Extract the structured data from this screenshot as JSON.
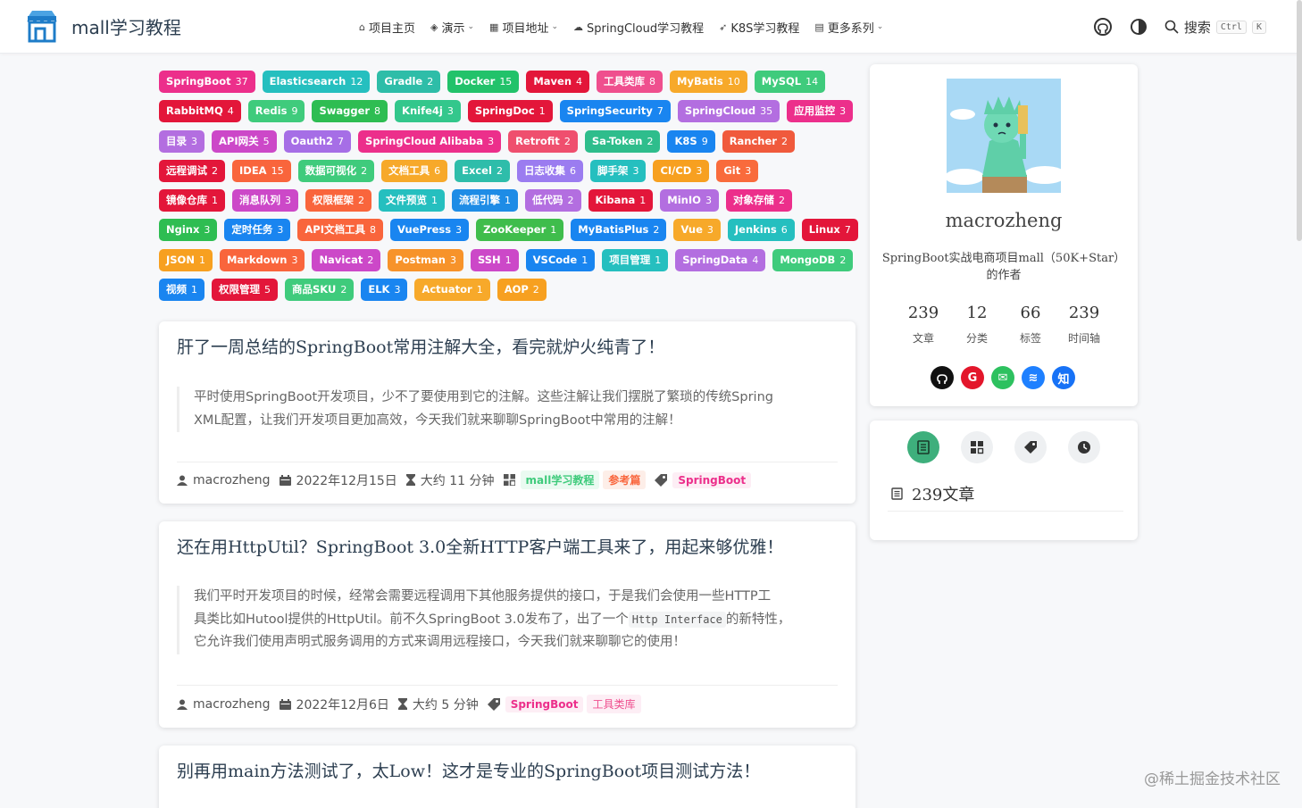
{
  "brand": {
    "name": "mall学习教程"
  },
  "nav": {
    "links": [
      {
        "icon": "home-icon",
        "label": "项目主页",
        "caret": false
      },
      {
        "icon": "cube-icon",
        "label": "演示",
        "caret": true
      },
      {
        "icon": "grid-icon",
        "label": "项目地址",
        "caret": true
      },
      {
        "icon": "cloud-icon",
        "label": "SpringCloud学习教程",
        "caret": false
      },
      {
        "icon": "rocket-icon",
        "label": "K8S学习教程",
        "caret": false
      },
      {
        "icon": "book-icon",
        "label": "更多系列",
        "caret": true
      }
    ],
    "search_label": "搜索",
    "kbd1": "Ctrl",
    "kbd2": "K"
  },
  "tags": [
    [
      [
        "SpringBoot",
        "37",
        "#ec2f8b"
      ],
      [
        "Elasticsearch",
        "12",
        "#25bfbf"
      ],
      [
        "Gradle",
        "2",
        "#2ebda8"
      ],
      [
        "Docker",
        "15",
        "#22c26a"
      ],
      [
        "Maven",
        "4",
        "#e3163a"
      ],
      [
        "工具类库",
        "8",
        "#ef4f8e"
      ],
      [
        "MyBatis",
        "10",
        "#f7a92a"
      ],
      [
        "MySQL",
        "14",
        "#3fcb7c"
      ]
    ],
    [
      [
        "RabbitMQ",
        "4",
        "#e3163a"
      ],
      [
        "Redis",
        "9",
        "#3fcb7c"
      ],
      [
        "Swagger",
        "8",
        "#2ebd52"
      ],
      [
        "Knife4j",
        "3",
        "#33c78c"
      ],
      [
        "SpringDoc",
        "1",
        "#e3163a"
      ],
      [
        "SpringSecurity",
        "7",
        "#1985f0"
      ],
      [
        "SpringCloud",
        "35",
        "#b36ee0"
      ],
      [
        "应用监控",
        "3",
        "#ec2f8b"
      ]
    ],
    [
      [
        "目录",
        "3",
        "#b36ee0"
      ],
      [
        "API网关",
        "5",
        "#cc48c8"
      ],
      [
        "Oauth2",
        "7",
        "#a66ee6"
      ],
      [
        "SpringCloud Alibaba",
        "3",
        "#ec2f8b"
      ],
      [
        "Retrofit",
        "2",
        "#ef4f6e"
      ],
      [
        "Sa-Token",
        "2",
        "#2ebd8c"
      ],
      [
        "K8S",
        "9",
        "#1985f0"
      ],
      [
        "Rancher",
        "2",
        "#f05a3c"
      ]
    ],
    [
      [
        "远程调试",
        "2",
        "#e3163a"
      ],
      [
        "IDEA",
        "15",
        "#f9653c"
      ],
      [
        "数据可视化",
        "2",
        "#3fcb7c"
      ],
      [
        "文档工具",
        "6",
        "#f7a92a"
      ],
      [
        "Excel",
        "2",
        "#2ebdaa"
      ],
      [
        "日志收集",
        "6",
        "#9b7cf0"
      ],
      [
        "脚手架",
        "3",
        "#25bfbf"
      ],
      [
        "CI/CD",
        "3",
        "#f7a020"
      ],
      [
        "Git",
        "3",
        "#f96b3c"
      ]
    ],
    [
      [
        "镜像仓库",
        "1",
        "#e3163a"
      ],
      [
        "消息队列",
        "3",
        "#cc48c8"
      ],
      [
        "权限框架",
        "2",
        "#f9653c"
      ],
      [
        "文件预览",
        "1",
        "#25bfbf"
      ],
      [
        "流程引擎",
        "1",
        "#1e8ce6"
      ],
      [
        "低代码",
        "2",
        "#b36ee0"
      ],
      [
        "Kibana",
        "1",
        "#e3163a"
      ],
      [
        "MinIO",
        "3",
        "#b36ee0"
      ],
      [
        "对象存储",
        "2",
        "#ec2f8b"
      ]
    ],
    [
      [
        "Nginx",
        "3",
        "#2ebd52"
      ],
      [
        "定时任务",
        "3",
        "#1985f0"
      ],
      [
        "API文档工具",
        "8",
        "#f9653c"
      ],
      [
        "VuePress",
        "3",
        "#1985f0"
      ],
      [
        "ZooKeeper",
        "1",
        "#3fbd4c"
      ],
      [
        "MyBatisPlus",
        "2",
        "#1985f0"
      ],
      [
        "Vue",
        "3",
        "#f7a92a"
      ],
      [
        "Jenkins",
        "6",
        "#25bfbf"
      ],
      [
        "Linux",
        "7",
        "#e3163a"
      ]
    ],
    [
      [
        "JSON",
        "1",
        "#f7a020"
      ],
      [
        "Markdown",
        "3",
        "#f9653c"
      ],
      [
        "Navicat",
        "2",
        "#cc48c8"
      ],
      [
        "Postman",
        "3",
        "#f7932a"
      ],
      [
        "SSH",
        "1",
        "#cc48c8"
      ],
      [
        "VSCode",
        "1",
        "#1985f0"
      ],
      [
        "项目管理",
        "1",
        "#25bfbf"
      ],
      [
        "SpringData",
        "4",
        "#b36ee0"
      ],
      [
        "MongoDB",
        "2",
        "#3fcb7c"
      ]
    ],
    [
      [
        "视频",
        "1",
        "#1985f0"
      ],
      [
        "权限管理",
        "5",
        "#e3163a"
      ],
      [
        "商品SKU",
        "2",
        "#3fcb7c"
      ],
      [
        "ELK",
        "3",
        "#1985f0"
      ],
      [
        "Actuator",
        "1",
        "#f7a92a"
      ],
      [
        "AOP",
        "2",
        "#f7a020"
      ]
    ]
  ],
  "articles": [
    {
      "title": "肝了一周总结的SpringBoot常用注解大全，看完就炉火纯青了！",
      "excerpt_1": "平时使用SpringBoot开发项目，少不了要使用到它的注解。这些注解让我们摆脱了繁琐的传统Spring",
      "excerpt_2": "XML配置，让我们开发项目更加高效，今天我们就来聊聊SpringBoot中常用的注解！",
      "author": "macrozheng",
      "date": "2022年12月15日",
      "read_time": "大约 11 分钟",
      "category_1": "mall学习教程",
      "category_2": "参考篇",
      "tag_1": "SpringBoot"
    },
    {
      "title": "还在用HttpUtil？SpringBoot 3.0全新HTTP客户端工具来了，用起来够优雅！",
      "excerpt_1": "我们平时开发项目的时候，经常会需要远程调用下其他服务提供的接口，于是我们会使用一些HTTP工",
      "excerpt_2a": "具类比如Hutool提供的HttpUtil。前不久SpringBoot 3.0发布了，出了一个",
      "excerpt_code": "Http Interface",
      "excerpt_2b": "的新特性，",
      "excerpt_3": "它允许我们使用声明式服务调用的方式来调用远程接口，今天我们就来聊聊它的使用！",
      "author": "macrozheng",
      "date": "2022年12月6日",
      "read_time": "大约 5 分钟",
      "tag_1": "SpringBoot",
      "tag_2": "工具类库"
    },
    {
      "title": "别再用main方法测试了，太Low！这才是专业的SpringBoot项目测试方法！"
    }
  ],
  "profile": {
    "name": "macrozheng",
    "desc": "SpringBoot实战电商项目mall（50K+Star）的作者",
    "stats": [
      {
        "num": "239",
        "label": "文章"
      },
      {
        "num": "12",
        "label": "分类"
      },
      {
        "num": "66",
        "label": "标签"
      },
      {
        "num": "239",
        "label": "时间轴"
      }
    ],
    "social": [
      {
        "icon": "github-icon",
        "text": "",
        "color": "#111111"
      },
      {
        "icon": "gitee-icon",
        "text": "G",
        "color": "#e3162b"
      },
      {
        "icon": "wechat-icon",
        "text": "",
        "color": "#2dc15f"
      },
      {
        "icon": "juejin-icon",
        "text": "",
        "color": "#1e80ff"
      },
      {
        "icon": "zhihu-icon",
        "text": "知",
        "color": "#1772f6"
      }
    ]
  },
  "side_tabs": {
    "active_label": "239文章"
  },
  "watermark": "@稀土掘金技术社区",
  "colors": {
    "accent": "#3eaf7c",
    "pink": "#ec2f8b"
  }
}
